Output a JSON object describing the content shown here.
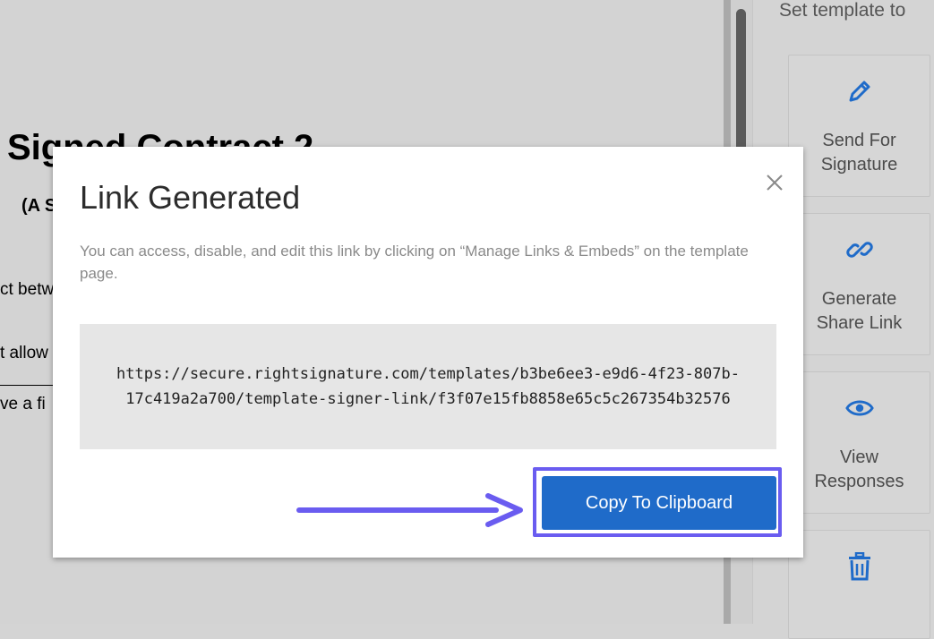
{
  "document": {
    "title": "Signed Contract 2",
    "subtitle": "(A S",
    "lines": [
      "ct betw",
      "t allow",
      "ve a fi"
    ]
  },
  "panel": {
    "heading": "Set template to",
    "actions": [
      {
        "label": "Send For Signature",
        "icon": "pen-icon"
      },
      {
        "label": "Generate Share Link",
        "icon": "link-icon"
      },
      {
        "label": "View Responses",
        "icon": "eye-icon"
      },
      {
        "label": "",
        "icon": "trash-icon"
      }
    ]
  },
  "modal": {
    "title": "Link Generated",
    "description": "You can access, disable, and edit this link by clicking on “Manage Links & Embeds” on the template page.",
    "link": "https://secure.rightsignature.com/templates/b3be6ee3-e9d6-4f23-807b-17c419a2a700/template-signer-link/f3f07e15fb8858e65c5c267354b32576",
    "copy_label": "Copy To Clipboard",
    "close_icon": "close-icon"
  },
  "colors": {
    "accent": "#1f6bc9",
    "highlight": "#6a5cf0",
    "icon_blue": "#1f6bc9"
  }
}
